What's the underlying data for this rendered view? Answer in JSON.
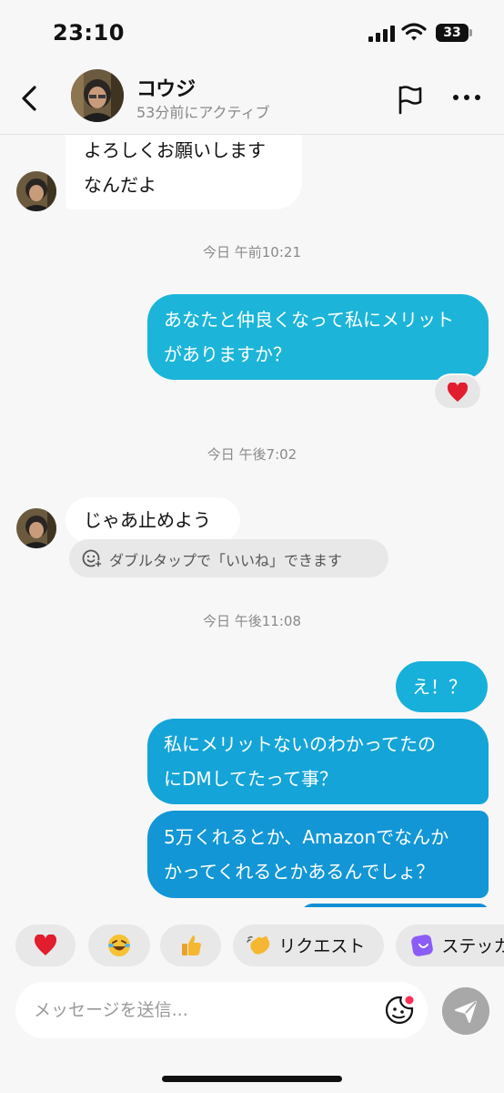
{
  "status_bar": {
    "time": "23:10",
    "battery": "33"
  },
  "header": {
    "contact_name": "コウジ",
    "active_status": "53分前にアクティブ"
  },
  "messages": [
    {
      "direction": "in",
      "lines": [
        "よろしくお願いします",
        "なんだよ"
      ]
    },
    {
      "direction": "timestamp",
      "text": "今日 午前10:21"
    },
    {
      "direction": "out",
      "lines": [
        "あなたと仲良くなって私にメリット",
        "がありますか？"
      ],
      "reaction": "heart"
    },
    {
      "direction": "timestamp",
      "text": "今日 午後7:02"
    },
    {
      "direction": "in",
      "lines": [
        "じゃあ止めよう"
      ]
    },
    {
      "direction": "timestamp",
      "text": "今日 午後11:08"
    },
    {
      "direction": "out",
      "lines": [
        "え！？"
      ]
    },
    {
      "direction": "out",
      "lines": [
        "私にメリットないのわかってたの",
        "にDMしてたって事？"
      ]
    },
    {
      "direction": "out",
      "lines": [
        "5万くれるとか、Amazonでなんか",
        "かってくれるとかあるんでしょ？"
      ]
    }
  ],
  "like_hint": "ダブルタップで「いいね」できます",
  "quick_actions": [
    {
      "icon": "heart-icon",
      "label": ""
    },
    {
      "icon": "laughing-face-icon",
      "label": ""
    },
    {
      "icon": "thumbs-up-icon",
      "label": ""
    },
    {
      "icon": "waving-hand-icon",
      "label": "リクエスト"
    },
    {
      "icon": "sticker-icon",
      "label": "ステッカ"
    }
  ],
  "composer": {
    "placeholder": "メッセージを送信..."
  },
  "colors": {
    "bubble_out_top": "#1cb5d9",
    "bubble_out_bottom": "#1296d6",
    "bubble_in": "#ffffff",
    "background": "#f7f7f7",
    "heart": "#e11d2e"
  }
}
